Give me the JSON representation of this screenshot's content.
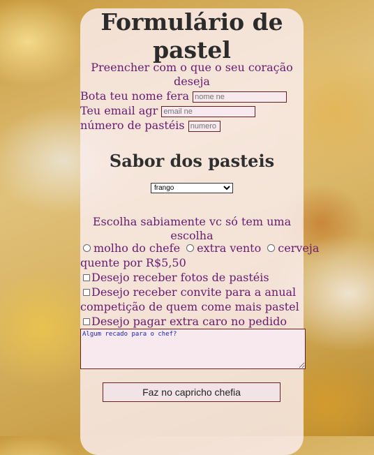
{
  "title": "Formulário de pastel",
  "subtitle": "Preencher com o que o seu coração deseja",
  "fields": {
    "name_label": "Bota teu nome fera",
    "name_placeholder": "nome ne",
    "email_label": "Teu email agr",
    "email_placeholder": "email ne",
    "count_label": "número de pastéis",
    "count_placeholder": "numero"
  },
  "flavor_heading": "Sabor dos pasteis",
  "flavor_select": {
    "selected": "frango"
  },
  "choose_text": "Escolha sabiamente vc só tem uma escolha",
  "radios": [
    "molho do chefe",
    "extra vento",
    "cerveja"
  ],
  "radio_suffix": "quente por R$5,50",
  "checkboxes": [
    "Desejo receber fotos de pastéis",
    "Desejo receber convite para a anual",
    "competição de quem come mais pastel",
    "Desejo pagar extra caro no pedido"
  ],
  "message_placeholder": "Algum recado para o chef?",
  "submit_label": "Faz no capricho chefia"
}
